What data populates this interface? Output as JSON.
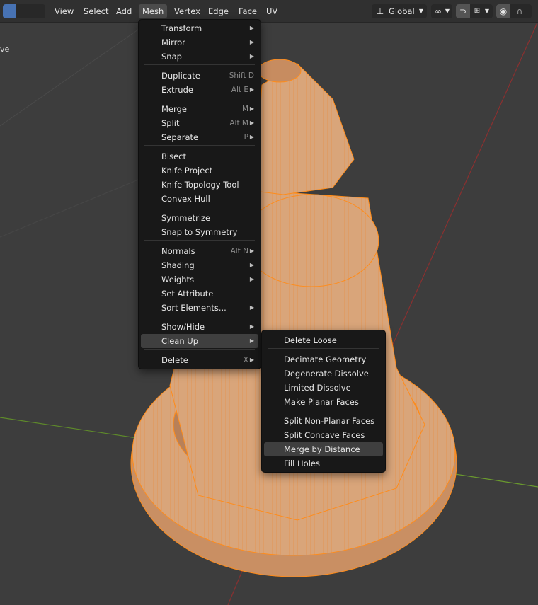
{
  "header": {
    "menus": [
      "View",
      "Select",
      "Add",
      "Mesh",
      "Vertex",
      "Edge",
      "Face",
      "UV"
    ],
    "transform_orientation": "Global"
  },
  "viewport": {
    "overlay_text": "ve"
  },
  "mesh_menu": {
    "items": [
      {
        "label": "Transform",
        "shortcut": "",
        "submenu": true
      },
      {
        "label": "Mirror",
        "shortcut": "",
        "submenu": true
      },
      {
        "label": "Snap",
        "shortcut": "",
        "submenu": true
      },
      {
        "label": "Duplicate",
        "shortcut": "Shift D",
        "submenu": false
      },
      {
        "label": "Extrude",
        "shortcut": "Alt E",
        "submenu": true
      },
      {
        "label": "Merge",
        "shortcut": "M",
        "submenu": true
      },
      {
        "label": "Split",
        "shortcut": "Alt M",
        "submenu": true
      },
      {
        "label": "Separate",
        "shortcut": "P",
        "submenu": true
      },
      {
        "label": "Bisect",
        "shortcut": "",
        "submenu": false
      },
      {
        "label": "Knife Project",
        "shortcut": "",
        "submenu": false
      },
      {
        "label": "Knife Topology Tool",
        "shortcut": "",
        "submenu": false
      },
      {
        "label": "Convex Hull",
        "shortcut": "",
        "submenu": false
      },
      {
        "label": "Symmetrize",
        "shortcut": "",
        "submenu": false
      },
      {
        "label": "Snap to Symmetry",
        "shortcut": "",
        "submenu": false
      },
      {
        "label": "Normals",
        "shortcut": "Alt N",
        "submenu": true
      },
      {
        "label": "Shading",
        "shortcut": "",
        "submenu": true
      },
      {
        "label": "Weights",
        "shortcut": "",
        "submenu": true
      },
      {
        "label": "Set Attribute",
        "shortcut": "",
        "submenu": false
      },
      {
        "label": "Sort Elements...",
        "shortcut": "",
        "submenu": true
      },
      {
        "label": "Show/Hide",
        "shortcut": "",
        "submenu": true
      },
      {
        "label": "Clean Up",
        "shortcut": "",
        "submenu": true
      },
      {
        "label": "Delete",
        "shortcut": "X",
        "submenu": true
      }
    ]
  },
  "cleanup_menu": {
    "items": [
      {
        "label": "Delete Loose"
      },
      {
        "label": "Decimate Geometry"
      },
      {
        "label": "Degenerate Dissolve"
      },
      {
        "label": "Limited Dissolve"
      },
      {
        "label": "Make Planar Faces"
      },
      {
        "label": "Split Non-Planar Faces"
      },
      {
        "label": "Split Concave Faces"
      },
      {
        "label": "Merge by Distance"
      },
      {
        "label": "Fill Holes"
      }
    ]
  },
  "colors": {
    "selection": "#ff8c1a",
    "menu_bg": "#181818",
    "header_bg": "#303030",
    "viewport_bg": "#3d3d3d",
    "accent": "#4772b3"
  }
}
